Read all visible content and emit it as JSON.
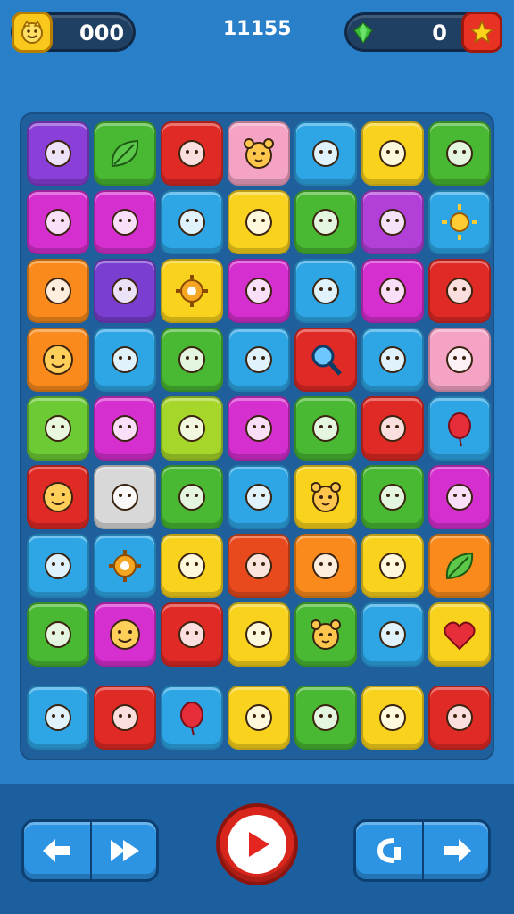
{
  "hud": {
    "coins_value": "000",
    "score": "11155",
    "gems_value": "0",
    "colors": {
      "coin": "#f8c91c",
      "gem": "#3cc03c",
      "star_button": "#e83324"
    }
  },
  "board": {
    "rows": [
      [
        {
          "color": "#8a3fd8",
          "icon": "cake-icon"
        },
        {
          "color": "#49b832",
          "icon": "leaf-icon"
        },
        {
          "color": "#e02a25",
          "icon": "sign-icon"
        },
        {
          "color": "#f5a3c4",
          "icon": "bear-face-icon"
        },
        {
          "color": "#2ea6e6",
          "icon": "swirl-icon"
        },
        {
          "color": "#f8d21c",
          "icon": "robot-face-icon"
        },
        {
          "color": "#49b832",
          "icon": "lollipop-icon"
        }
      ],
      [
        {
          "color": "#d62fd0",
          "icon": "play-badge-icon"
        },
        {
          "color": "#d62fd0",
          "icon": "house-icon"
        },
        {
          "color": "#2ea6e6",
          "icon": "hammer-icon"
        },
        {
          "color": "#f8d21c",
          "icon": "paddle-icon"
        },
        {
          "color": "#49b832",
          "icon": "berry-icon"
        },
        {
          "color": "#b23fd8",
          "icon": "speech-bubble-icon"
        },
        {
          "color": "#2ea6e6",
          "icon": "sun-icon"
        }
      ],
      [
        {
          "color": "#f98a1b",
          "icon": "chat-icon"
        },
        {
          "color": "#7a3fd0",
          "icon": "heart-leaf-icon"
        },
        {
          "color": "#f8d21c",
          "icon": "gear-icon"
        },
        {
          "color": "#d62fd0",
          "icon": "letters-icon"
        },
        {
          "color": "#2ea6e6",
          "icon": "crossed-circle-icon"
        },
        {
          "color": "#d62fd0",
          "icon": "brush-icon"
        },
        {
          "color": "#e02a25",
          "icon": "letter-g-icon"
        }
      ],
      [
        {
          "color": "#f98a1b",
          "icon": "smiley-icon"
        },
        {
          "color": "#2ea6e6",
          "icon": "chick-icon"
        },
        {
          "color": "#49b832",
          "icon": "pencil-frame-icon"
        },
        {
          "color": "#2ea6e6",
          "icon": "ring-icon"
        },
        {
          "color": "#e02a25",
          "icon": "magnifier-icon"
        },
        {
          "color": "#2ea6e6",
          "icon": "drumstick-icon"
        },
        {
          "color": "#f5a3c4",
          "icon": "chick-face-icon"
        }
      ],
      [
        {
          "color": "#6ccb34",
          "icon": "chat-bubble-icon"
        },
        {
          "color": "#d62fd0",
          "icon": "splat-icon"
        },
        {
          "color": "#a6d62a",
          "icon": "snail-icon"
        },
        {
          "color": "#d62fd0",
          "icon": "bat-icon"
        },
        {
          "color": "#49b832",
          "icon": "bars-icon"
        },
        {
          "color": "#e02a25",
          "icon": "spiral-icon"
        },
        {
          "color": "#2ea6e6",
          "icon": "balloon-icon"
        }
      ],
      [
        {
          "color": "#e02a25",
          "icon": "smiley-icon"
        },
        {
          "color": "#d8d8d8",
          "icon": "helmet-icon"
        },
        {
          "color": "#49b832",
          "icon": "radio-icon"
        },
        {
          "color": "#2ea6e6",
          "icon": "brush-tip-icon"
        },
        {
          "color": "#f8d21c",
          "icon": "bear-face-icon"
        },
        {
          "color": "#49b832",
          "icon": "apple-icon"
        },
        {
          "color": "#d62fd0",
          "icon": "bandage-icon"
        }
      ],
      [
        {
          "color": "#2ea6e6",
          "icon": "apple-heart-icon"
        },
        {
          "color": "#2ea6e6",
          "icon": "gear-icon"
        },
        {
          "color": "#f8d21c",
          "icon": "people-icon"
        },
        {
          "color": "#e84a1e",
          "icon": "wrench-icon"
        },
        {
          "color": "#f98a1b",
          "icon": "key-icon"
        },
        {
          "color": "#f8d21c",
          "icon": "cat-face-icon"
        },
        {
          "color": "#f98a1b",
          "icon": "leaf-icon"
        }
      ],
      [
        {
          "color": "#49b832",
          "icon": "strawberry-icon"
        },
        {
          "color": "#d62fd0",
          "icon": "smiley-icon"
        },
        {
          "color": "#e02a25",
          "icon": "pin-icon"
        },
        {
          "color": "#f8d21c",
          "icon": "ticket-icon"
        },
        {
          "color": "#49b832",
          "icon": "bear-face-icon"
        },
        {
          "color": "#2ea6e6",
          "icon": "maple-leaf-icon"
        },
        {
          "color": "#f8d21c",
          "icon": "heart-icon"
        }
      ],
      [
        {
          "color": "#2ea6e6",
          "icon": "ghost-icon"
        },
        {
          "color": "#e02a25",
          "icon": "pretzel-icon"
        },
        {
          "color": "#2ea6e6",
          "icon": "balloon-icon"
        },
        {
          "color": "#f8d21c",
          "icon": "cross-icon"
        },
        {
          "color": "#49b832",
          "icon": "leaf-ball-icon"
        },
        {
          "color": "#f8d21c",
          "icon": "ping-pong-icon"
        },
        {
          "color": "#e02a25",
          "icon": "sheep-icon"
        }
      ]
    ]
  },
  "controls": {
    "left_pair": [
      "arrow-left-icon",
      "fast-forward-icon"
    ],
    "play_icon": "play-icon",
    "right_pair": [
      "undo-icon",
      "arrow-right-icon"
    ]
  }
}
